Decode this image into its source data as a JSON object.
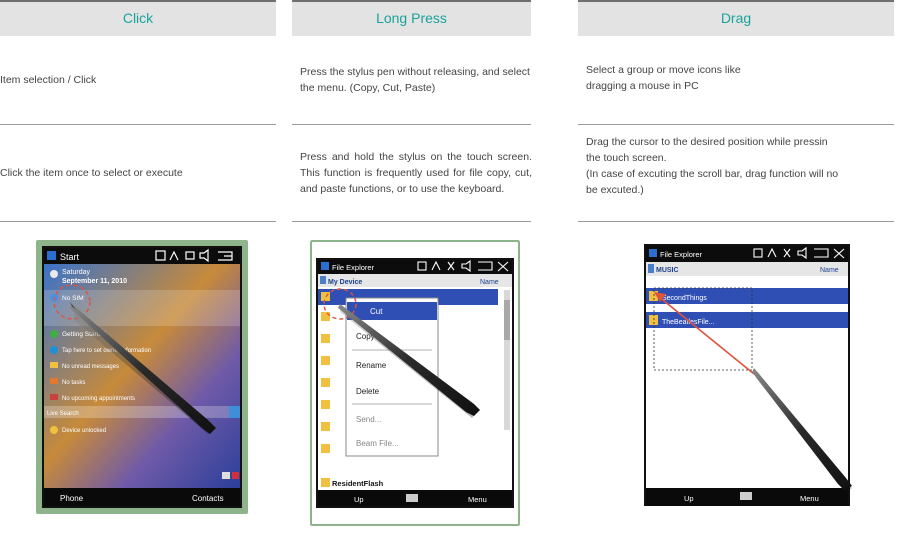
{
  "columns": [
    {
      "header": "Click",
      "row1": "Item selection / Click",
      "row2": "Click the item once to select or execute"
    },
    {
      "header": "Long Press",
      "row1": "Press the stylus pen without releasing, and select the menu. (Copy, Cut, Paste)",
      "row2": "Press and hold the stylus on the touch screen. This function is frequently used for file copy, cut, and paste functions, or to use the keyboard."
    },
    {
      "header": "Drag",
      "row1_line1": "Select a group or move icons like",
      "row1_line2": "dragging a mouse in PC",
      "row2_line1": "Drag the cursor to the desired position while pressin",
      "row2_line2": "the touch screen.",
      "row2_line3": "(In case of excuting the scroll bar, drag function will no",
      "row2_line4": "be excuted.)"
    }
  ],
  "screen1": {
    "title": "Start",
    "day": "Saturday",
    "date": "September 11, 2010",
    "item1": "No SIM",
    "item2": "Getting Started",
    "item3": "Tap here to set owner information",
    "item4": "No unread messages",
    "item5": "No tasks",
    "item6": "No upcoming appointments",
    "search": "Live Search",
    "item7": "Device unlocked",
    "soft_left": "Phone",
    "soft_right": "Contacts"
  },
  "screen2": {
    "title": "File Explorer",
    "folder": "My Device",
    "sort": "Name",
    "menu": [
      "Cut",
      "Copy",
      "Rename",
      "Delete",
      "Send...",
      "Beam File..."
    ],
    "last_item": "ResidentFlash",
    "soft_left": "Up",
    "soft_right": "Menu"
  },
  "screen3": {
    "title": "File Explorer",
    "folder": "MUSIC",
    "sort": "Name",
    "item1": "SecondThings",
    "item2": "TheBeatlesFile...",
    "soft_left": "Up",
    "soft_right": "Menu"
  },
  "colors": {
    "header_text": "#1aa39c",
    "header_bg": "#e3e3e3",
    "frame_green": "#8fb38a",
    "selection_blue": "#2f4fb5",
    "drag_arrow": "#e0523a"
  }
}
